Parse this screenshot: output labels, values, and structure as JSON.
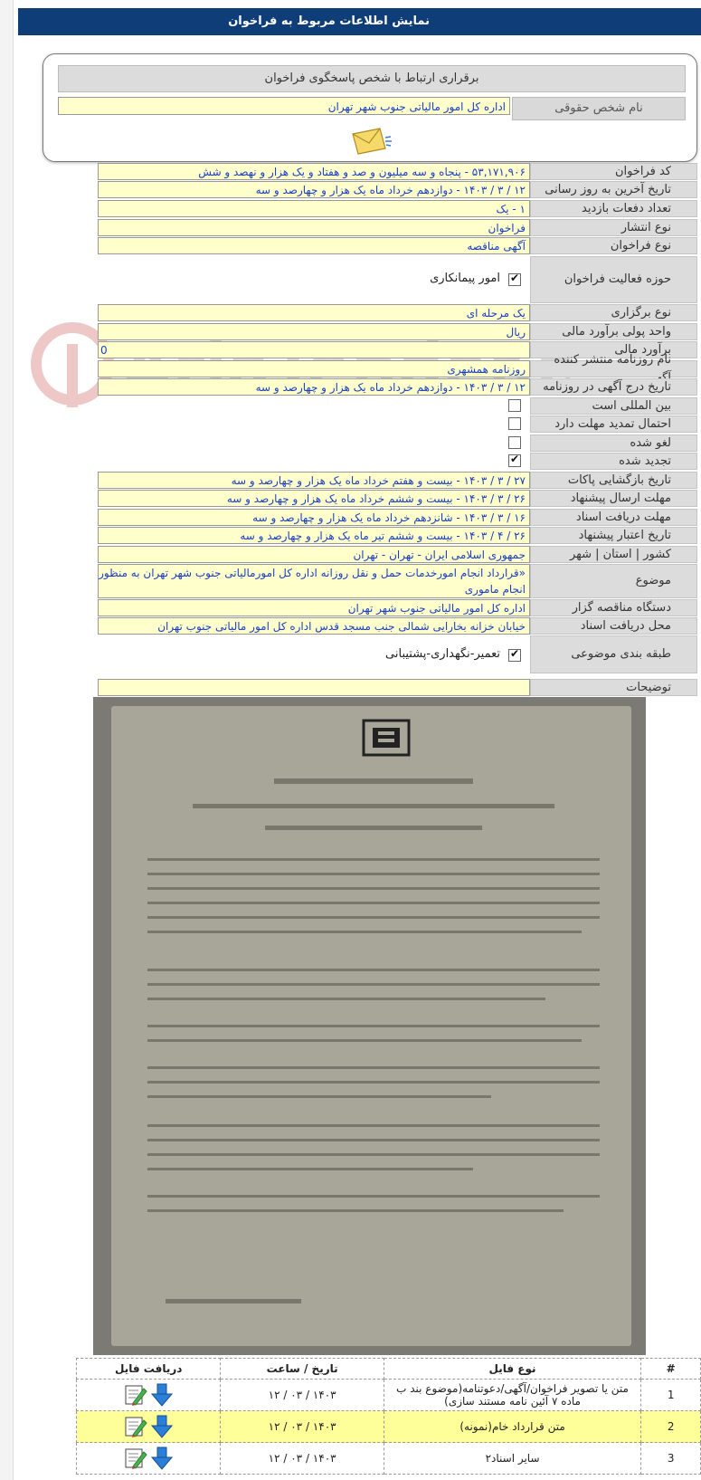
{
  "header": {
    "title": "نمایش اطلاعات مربوط به فراخوان"
  },
  "contact": {
    "heading": "برقراری ارتباط با شخص پاسخگوی فراخوان",
    "legal_person_label": "نام شخص حقوقی",
    "legal_person_value": "اداره کل امور مالیاتی جنوب شهر تهران",
    "mail_icon": "envelope-icon"
  },
  "fields": {
    "code_label": "کد فراخوان",
    "code_value": "۵۳,۱۷۱,۹۰۶ - پنجاه و سه میلیون و صد و هفتاد و یک هزار و نهصد و شش",
    "last_update_label": "تاریخ آخرین به روز رسانی",
    "last_update_value": "۱۲ / ۳ / ۱۴۰۳ - دوازدهم خرداد ماه یک هزار و چهارصد و سه",
    "visits_label": "تعداد دفعات بازدید",
    "visits_value": "۱ - یک",
    "publish_type_label": "نوع انتشار",
    "publish_type_value": "فراخوان",
    "call_type_label": "نوع فراخوان",
    "call_type_value": "آگهی مناقصه",
    "activity_label": "حوزه فعالیت فراخوان",
    "activity_value": "امور پیمانکاری",
    "hold_type_label": "نوع برگزاری",
    "hold_type_value": "یک مرحله ای",
    "currency_label": "واحد پولی برآورد مالی",
    "currency_value": "ریال",
    "estimate_label": "برآورد مالی",
    "estimate_value": "0",
    "newspaper_label": "نام روزنامه منتشر کننده آگهی",
    "newspaper_value": "روزنامه همشهری",
    "newspaper_date_label": "تاریخ درج آگهی در روزنامه",
    "newspaper_date_value": "۱۲ / ۳ / ۱۴۰۳ - دوازدهم خرداد ماه یک هزار و چهارصد و سه",
    "international_label": "بین المللی است",
    "extension_label": "احتمال تمدید مهلت دارد",
    "cancelled_label": "لغو شده",
    "renewed_label": "تجدید شده",
    "opening_date_label": "تاریخ بازگشایی پاکات",
    "opening_date_value": "۲۷ / ۳ / ۱۴۰۳ - بیست و هفتم خرداد ماه یک هزار و چهارصد و سه",
    "submit_deadline_label": "مهلت ارسال پیشنهاد",
    "submit_deadline_value": "۲۶ / ۳ / ۱۴۰۳ - بیست و ششم خرداد ماه یک هزار و چهارصد و سه",
    "docs_deadline_label": "مهلت دریافت اسناد",
    "docs_deadline_value": "۱۶ / ۳ / ۱۴۰۳ - شانزدهم خرداد ماه یک هزار و چهارصد و سه",
    "validity_label": "تاریخ اعتبار پیشنهاد",
    "validity_value": "۲۶ / ۴ / ۱۴۰۳ - بیست و ششم تیر ماه یک هزار و چهارصد و سه",
    "location_label": "کشور | استان | شهر",
    "location_value": "جمهوری اسلامی ایران - تهران - تهران",
    "subject_label": "موضوع",
    "subject_value": "«قرارداد انجام امورخدمات حمل و نقل روزانه اداره کل امورمالیاتی جنوب شهر تهران به منظور انجام ماموری",
    "organizer_label": "دستگاه مناقصه گزار",
    "organizer_value": "اداره کل امور مالیاتی جنوب شهر تهران",
    "docs_place_label": "محل دریافت اسناد",
    "docs_place_value": "خیابان خزانه بخارایی شمالی جنب مسجد قدس اداره کل امور مالیاتی جنوب تهران",
    "category_label": "طبقه بندی موضوعی",
    "category_value": "تعمیر-نگهداری-پشتیبانی",
    "notes_label": "توضیحات"
  },
  "watermark_text": "AriaTender.net",
  "files": {
    "headers": [
      "#",
      "نوع فایل",
      "تاریخ / ساعت",
      "دریافت فایل"
    ],
    "rows": [
      {
        "num": "1",
        "type": "متن یا تصویر فراخوان/آگهی/دعوتنامه(موضوع بند ب ماده ۷ آئین نامه مستند سازی)",
        "date": "۱۲ / ۰۳ / ۱۴۰۳"
      },
      {
        "num": "2",
        "type": "متن قرارداد خام(نمونه)",
        "date": "۱۲ / ۰۳ / ۱۴۰۳"
      },
      {
        "num": "3",
        "type": "سایر اسناد۲",
        "date": "۱۲ / ۰۳ / ۱۴۰۳"
      }
    ]
  }
}
